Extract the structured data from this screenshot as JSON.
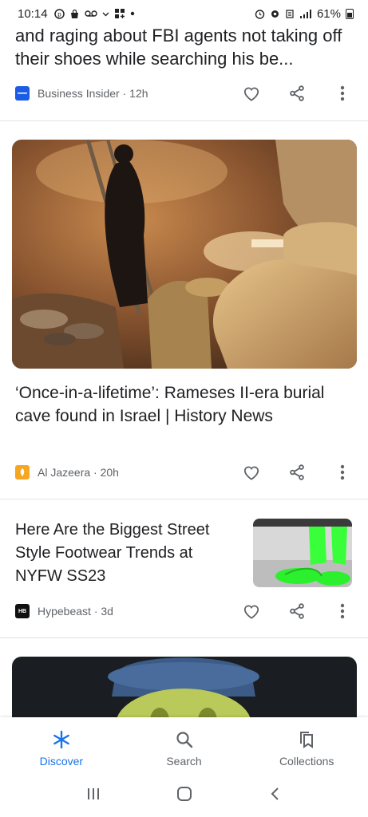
{
  "status_bar": {
    "time": "10:14",
    "battery": "61%"
  },
  "feed": {
    "partial_article": {
      "title": "and raging about FBI agents not taking off their shoes while searching his be...",
      "source": "Business Insider · 12h"
    },
    "articles": [
      {
        "title": "‘Once-in-a-lifetime’: Rameses II-era burial cave found in Israel | History News",
        "source": "Al Jazeera · 20h"
      },
      {
        "title": "Here Are the Biggest Street Style Footwear Trends at NYFW SS23",
        "source": "Hypebeast · 3d",
        "logo_text": "HB"
      }
    ]
  },
  "bottom_nav": {
    "items": [
      {
        "label": "Discover",
        "icon": "asterisk-icon",
        "active": true
      },
      {
        "label": "Search",
        "icon": "search-icon",
        "active": false
      },
      {
        "label": "Collections",
        "icon": "collections-icon",
        "active": false
      }
    ]
  },
  "colors": {
    "accent": "#1a73e8",
    "text": "#202124",
    "secondary_text": "#5f6368",
    "business_insider_logo": "#1a5ce6",
    "al_jazeera_logo": "#f5a623",
    "hypebeast_logo": "#111111"
  }
}
